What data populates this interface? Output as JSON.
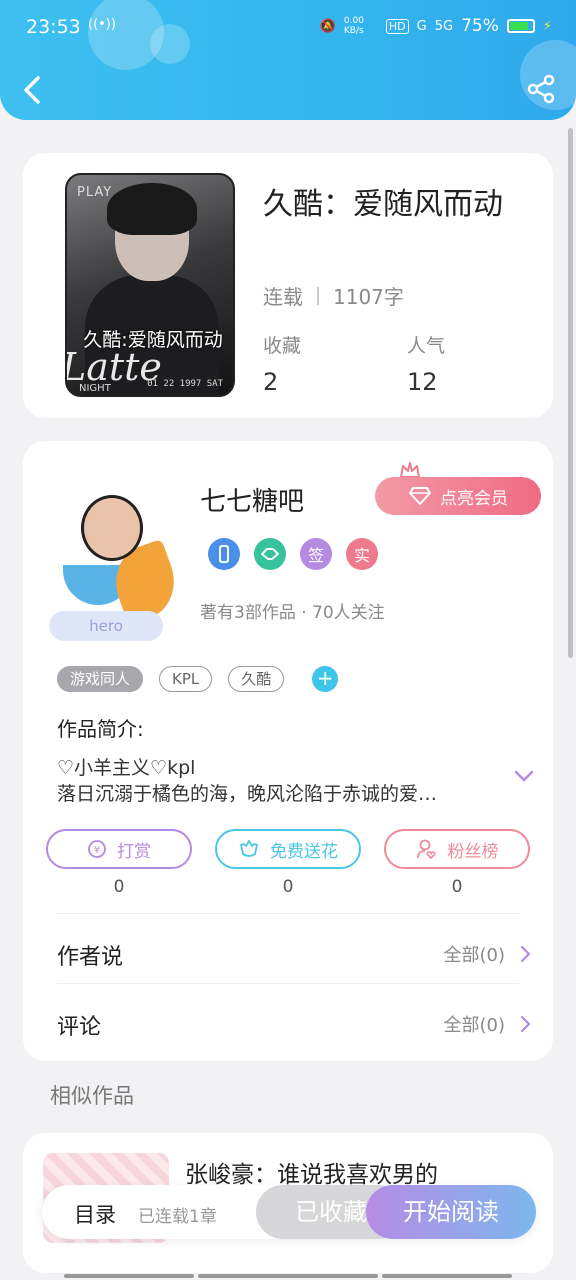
{
  "status_bar": {
    "time": "23:53",
    "net_speed": "0.00 KB/s",
    "hd": "HD",
    "signal1": "G",
    "signal2": "5G",
    "battery": "75%"
  },
  "book": {
    "title": "久酷：爱随风而动",
    "cover_play": "PLAY",
    "cover_title": "久酷:爱随风而动",
    "cover_script": "Latte",
    "cover_night": "NIGHT",
    "cover_date": "01 22 1997 SAT",
    "status": "连载",
    "words": "1107字",
    "fav_label": "收藏",
    "fav_count": "2",
    "pop_label": "人气",
    "pop_count": "12"
  },
  "author": {
    "name": "七七糖吧",
    "hero": "hero",
    "vip_button": "点亮会员",
    "badges": [
      "签",
      "实"
    ],
    "works": "著有3部作品 · 70人关注",
    "tags": [
      "游戏同人",
      "KPL",
      "久酷"
    ],
    "add_tag": "+",
    "intro_label": "作品简介:",
    "intro_line1": "♡小羊主义♡kpl",
    "intro_line2": "落日沉溺于橘色的海，晚风沦陷于赤诚的爱…",
    "actions": [
      {
        "label": "打赏",
        "count": "0",
        "color": "#b58be2"
      },
      {
        "label": "免费送花",
        "count": "0",
        "color": "#49c7e4"
      },
      {
        "label": "粉丝榜",
        "count": "0",
        "color": "#ef8a9a"
      }
    ],
    "author_says": "作者说",
    "author_says_all": "全部(0)",
    "comments": "评论",
    "comments_all": "全部(0)"
  },
  "similar": {
    "label": "相似作品",
    "item_title": "张峻豪：谁说我喜欢男的"
  },
  "bottom": {
    "toc": "目录",
    "toc_sub": "已连载1章",
    "fav": "已收藏",
    "read": "开始阅读"
  }
}
